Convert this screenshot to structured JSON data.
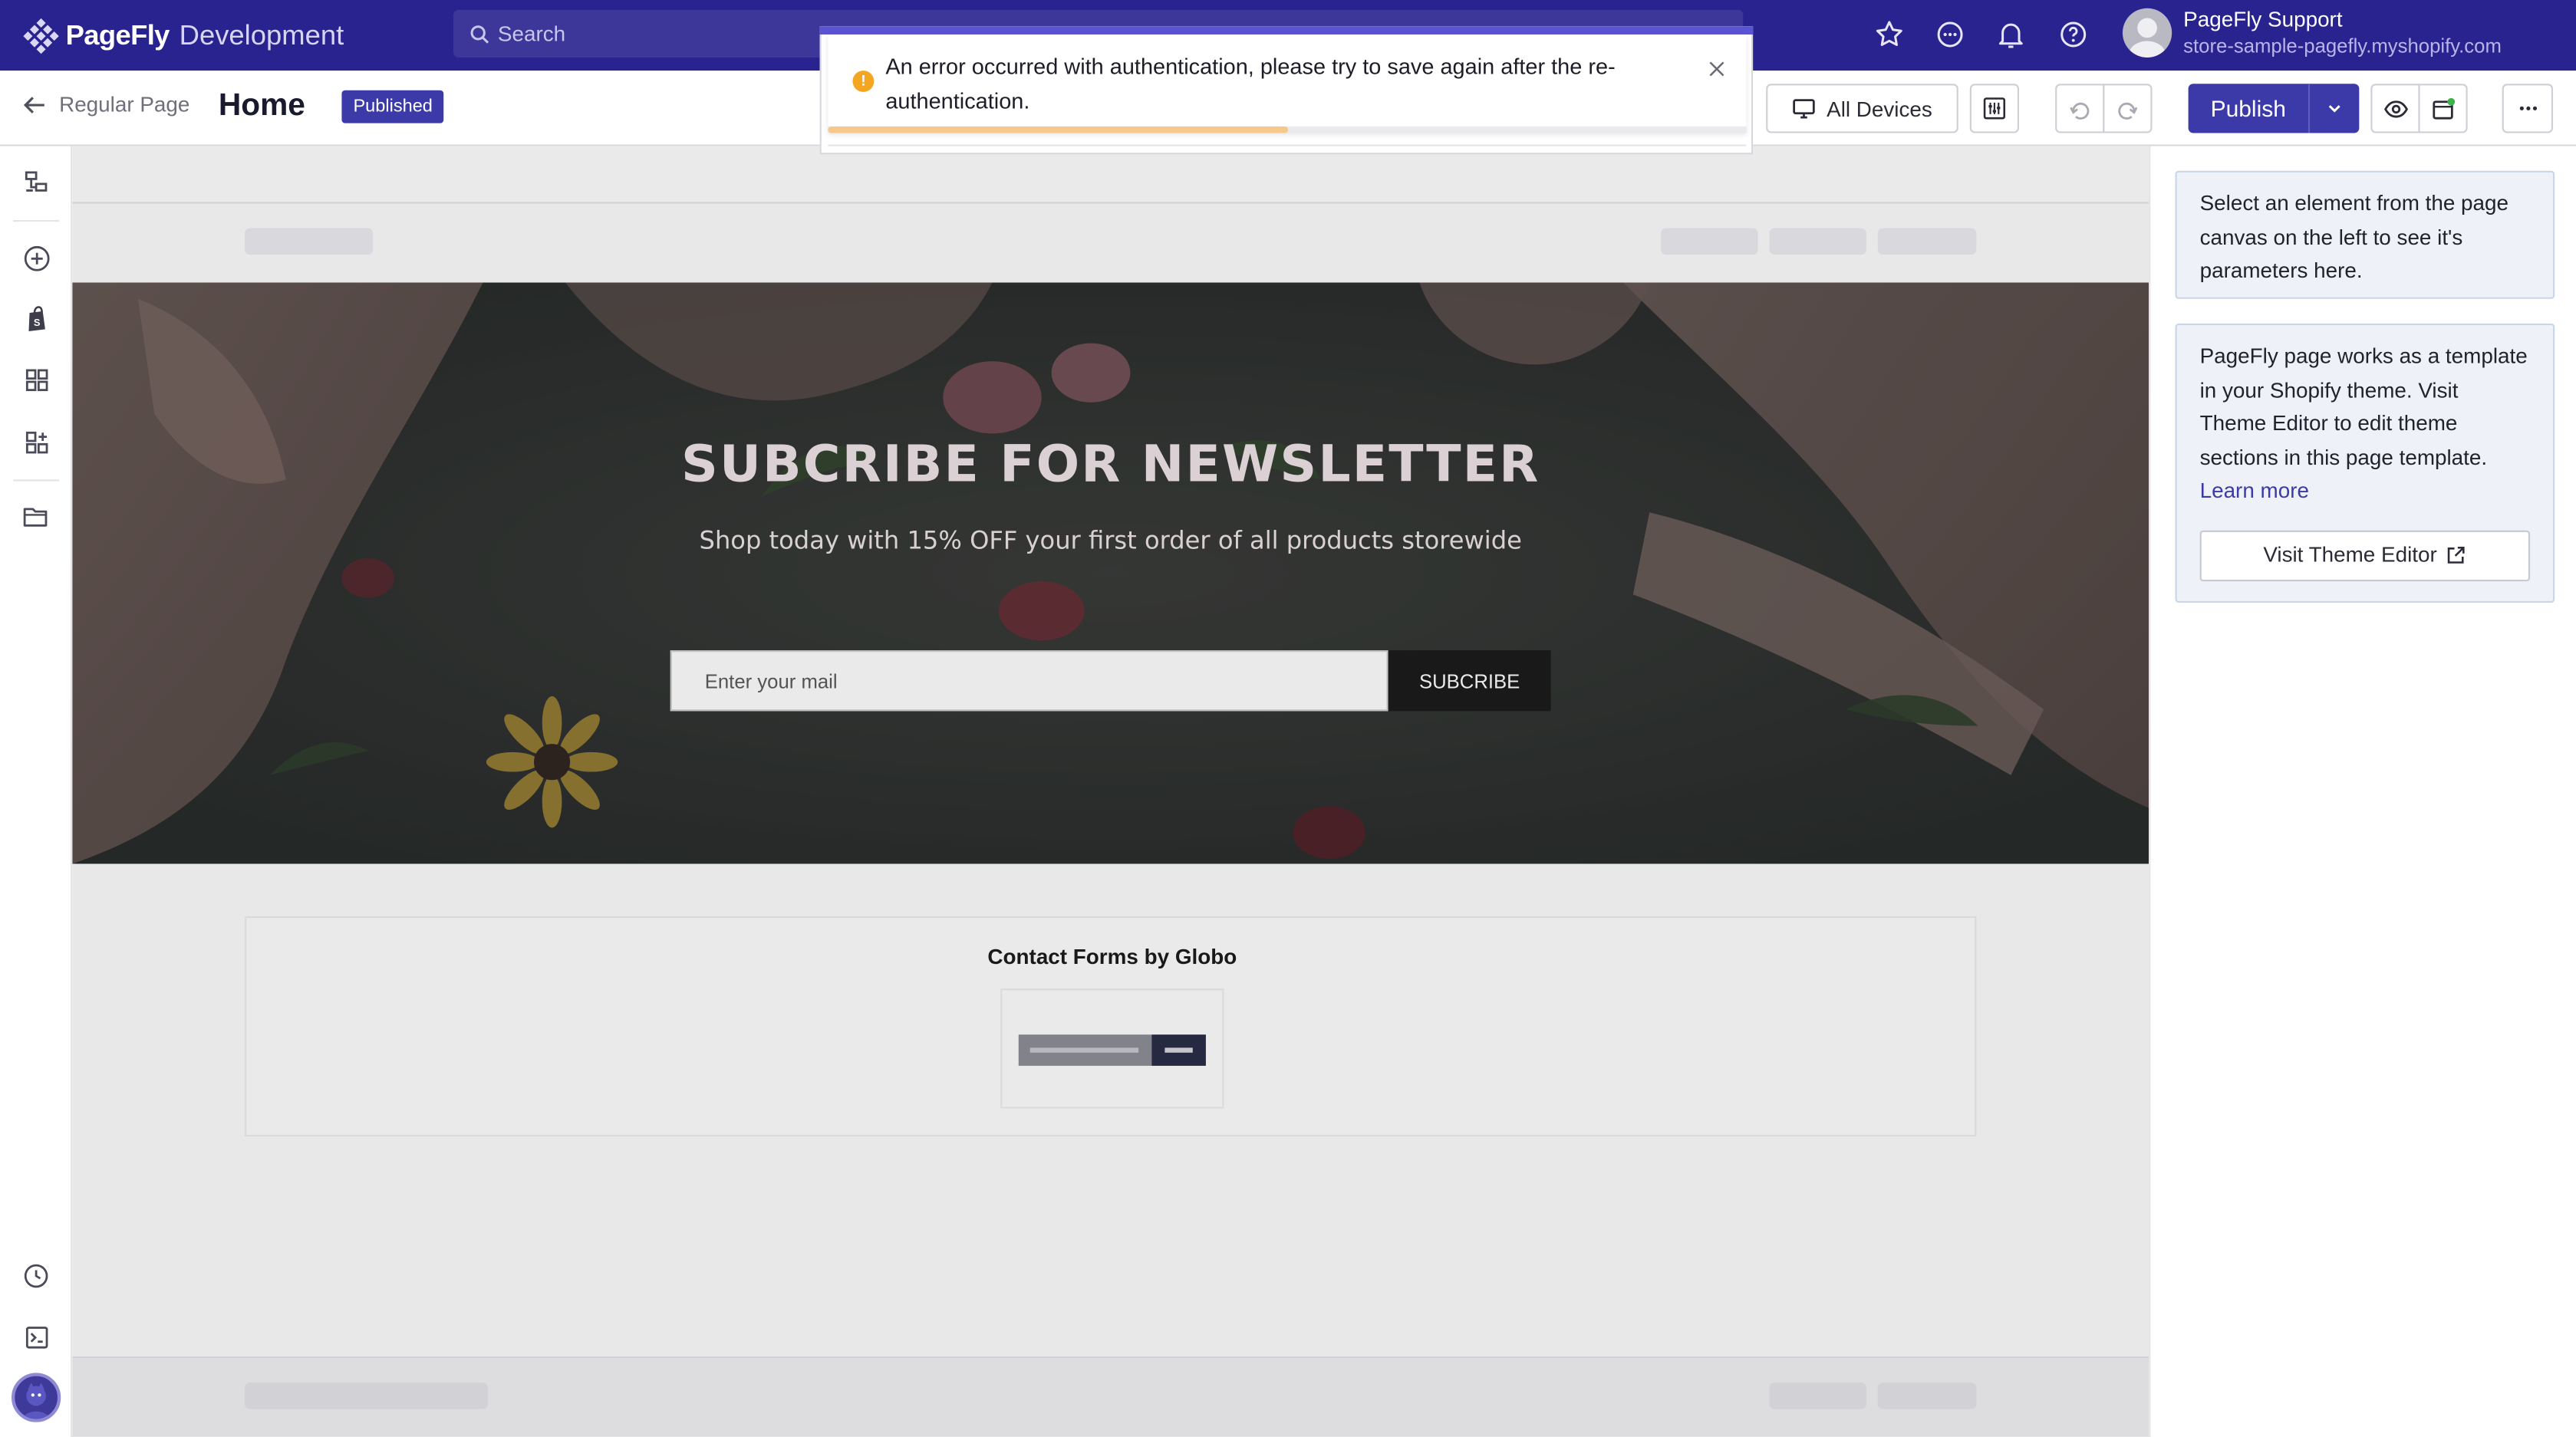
{
  "topbar": {
    "brand_name": "PageFly",
    "brand_env": "Development",
    "search_placeholder": "Search",
    "user_name": "PageFly Support",
    "user_store": "store-sample-pagefly.myshopify.com"
  },
  "subbar": {
    "back_label": "Regular Page",
    "page_title": "Home",
    "status_badge": "Published",
    "devices_label": "All Devices",
    "publish_label": "Publish"
  },
  "hero": {
    "title": "SUBCRIBE FOR NEWSLETTER",
    "subtitle": "Shop today with 15% OFF your first order of all products storewide",
    "email_placeholder": "Enter your mail",
    "subscribe_label": "SUBCRIBE"
  },
  "contact": {
    "title": "Contact Forms by Globo"
  },
  "right_panel": {
    "select_hint": "Select an element from the page canvas on the left to see it's parameters here.",
    "theme_info": "PageFly page works as a template in your Shopify theme. Visit Theme Editor to edit theme sections in this page template.",
    "learn_more": "Learn more",
    "visit_theme_editor": "Visit Theme Editor"
  },
  "toast": {
    "message": "An error occurred with authentication, please try to save again after the re-authentication.",
    "type": "warning",
    "progress_fraction": 0.5
  },
  "colors": {
    "brand": "#29238f",
    "accent": "#3b3aa8",
    "warning": "#f4a522",
    "progress": "#f6c88b"
  },
  "icons": {
    "topbar": [
      "star-icon",
      "chat-icon",
      "bell-icon",
      "help-icon"
    ],
    "left_rail": [
      "layers-icon",
      "add-icon",
      "shopify-icon",
      "grid-icon",
      "apps-icon",
      "folder-icon",
      "history-icon",
      "terminal-icon"
    ]
  }
}
